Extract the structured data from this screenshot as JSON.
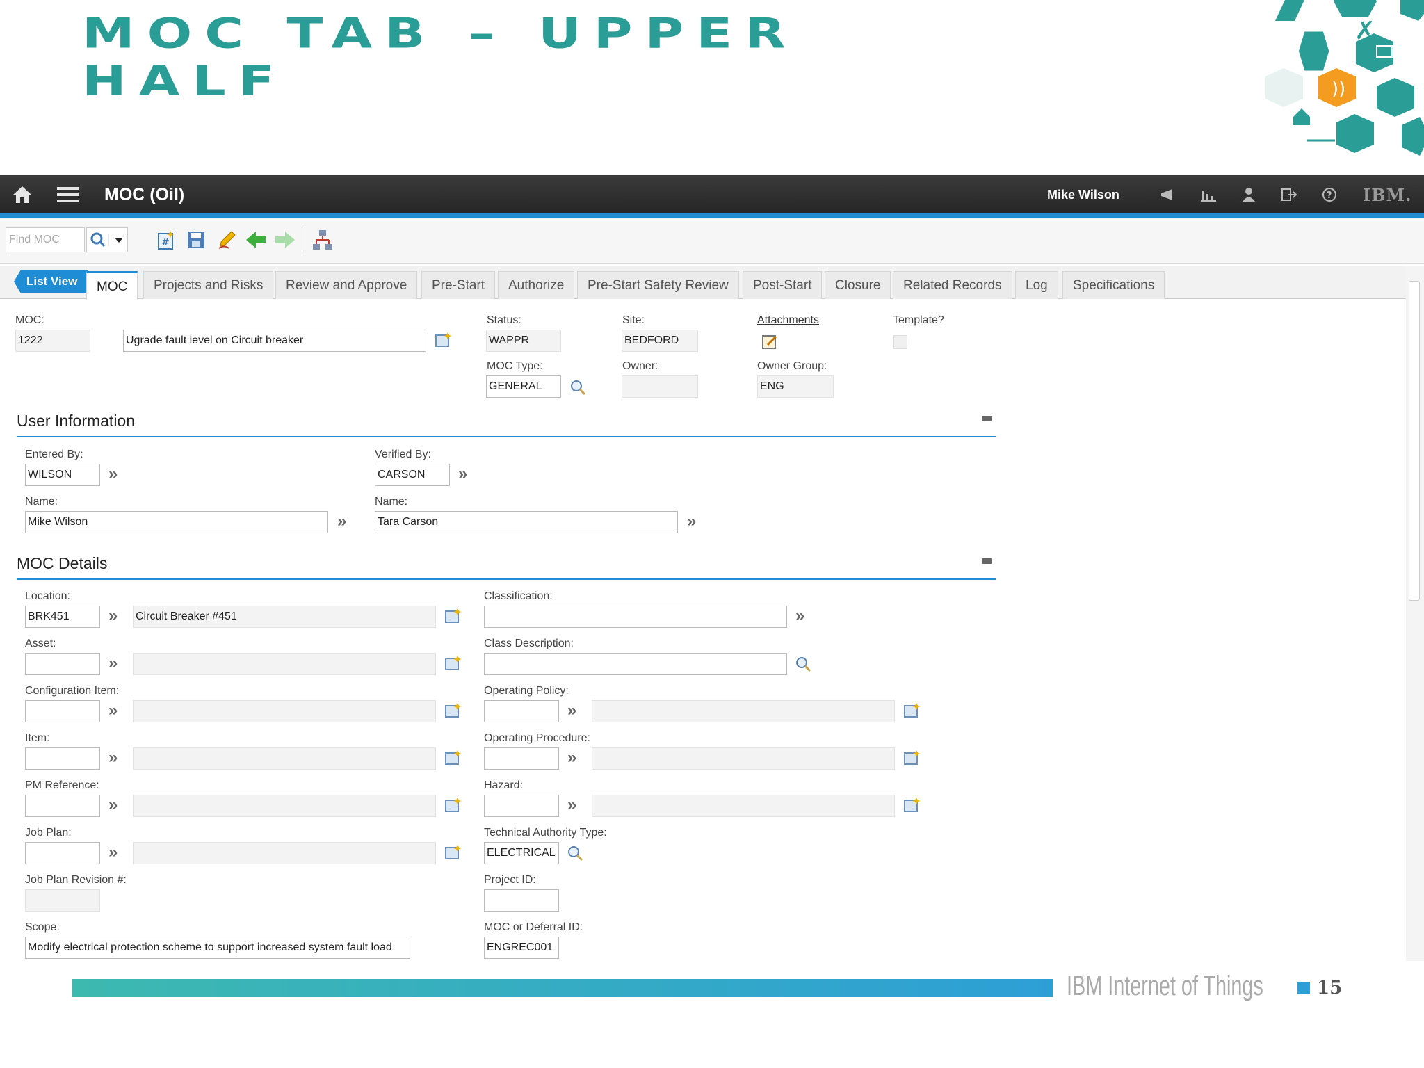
{
  "slide": {
    "title": "MOC TAB – UPPER HALF",
    "footer": "IBM Internet of Things",
    "page_number": "15"
  },
  "app": {
    "title": "MOC (Oil)",
    "user": "Mike Wilson",
    "logo": "IBM.",
    "find_placeholder": "Find MOC",
    "list_view": "List View",
    "tabs": [
      "MOC",
      "Projects and Risks",
      "Review and Approve",
      "Pre-Start",
      "Authorize",
      "Pre-Start Safety Review",
      "Post-Start",
      "Closure",
      "Related Records",
      "Log",
      "Specifications"
    ],
    "active_tab": "MOC"
  },
  "header": {
    "moc_label": "MOC:",
    "moc_value": "1222",
    "description": "Ugrade fault level on Circuit breaker",
    "status_label": "Status:",
    "status_value": "WAPPR",
    "site_label": "Site:",
    "site_value": "BEDFORD",
    "attachments_label": "Attachments",
    "template_label": "Template?",
    "moc_type_label": "MOC Type:",
    "moc_type_value": "GENERAL",
    "owner_label": "Owner:",
    "owner_value": "",
    "owner_group_label": "Owner Group:",
    "owner_group_value": "ENG"
  },
  "user_info": {
    "section_title": "User Information",
    "entered_by_label": "Entered By:",
    "entered_by_value": "WILSON",
    "verified_by_label": "Verified By:",
    "verified_by_value": "CARSON",
    "name_label": "Name:",
    "entered_name": "Mike Wilson",
    "verified_name": "Tara Carson"
  },
  "details": {
    "section_title": "MOC Details",
    "location_label": "Location:",
    "location_value": "BRK451",
    "location_desc": "Circuit Breaker #451",
    "asset_label": "Asset:",
    "config_label": "Configuration Item:",
    "item_label": "Item:",
    "pm_label": "PM Reference:",
    "jobplan_label": "Job Plan:",
    "jobplan_rev_label": "Job Plan Revision #:",
    "scope_label": "Scope:",
    "scope_value": "Modify electrical protection scheme to support increased system fault load",
    "classification_label": "Classification:",
    "class_desc_label": "Class Description:",
    "op_policy_label": "Operating Policy:",
    "op_procedure_label": "Operating Procedure:",
    "hazard_label": "Hazard:",
    "tech_auth_label": "Technical Authority Type:",
    "tech_auth_value": "ELECTRICAL",
    "project_id_label": "Project ID:",
    "deferral_label": "MOC or Deferral ID:",
    "deferral_value": "ENGREC001"
  },
  "colors": {
    "accent": "#1f8dd6",
    "title_teal": "#2a9d96",
    "orange": "#f39c1f"
  }
}
